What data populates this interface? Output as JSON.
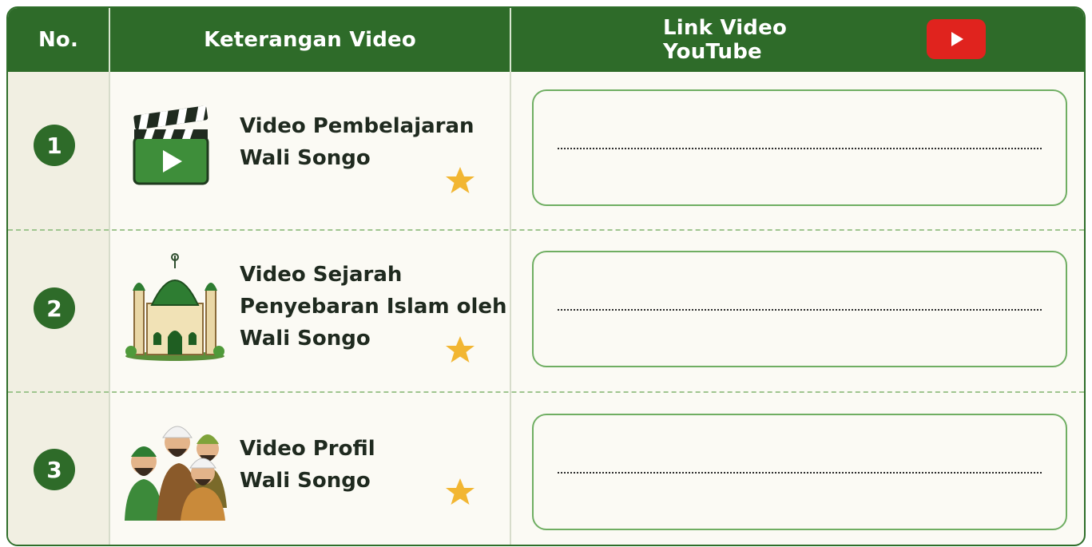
{
  "header": {
    "no": "No.",
    "keterangan": "Keterangan Video",
    "link": "Link Video YouTube"
  },
  "rows": [
    {
      "number": "1",
      "line1": "Video Pembelajaran",
      "line2": "Wali Songo",
      "line3": "",
      "icon": "clapperboard-icon"
    },
    {
      "number": "2",
      "line1": "Video Sejarah",
      "line2": "Penyebaran Islam oleh",
      "line3": "Wali Songo",
      "icon": "mosque-icon"
    },
    {
      "number": "3",
      "line1": "Video Profil",
      "line2": "Wali Songo",
      "line3": "",
      "icon": "wali-songo-figures-icon"
    }
  ],
  "colors": {
    "header_green": "#2e6b29",
    "star": "#f2b632",
    "youtube_red": "#e0231e"
  }
}
